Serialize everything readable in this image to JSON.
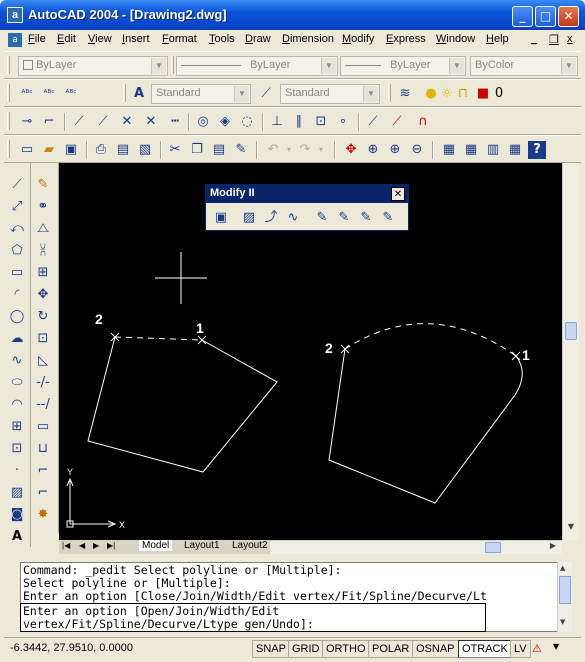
{
  "window": {
    "title": "AutoCAD 2004 - [Drawing2.dwg]",
    "app_icon_letter": "a",
    "controls": {
      "minimize": "_",
      "maximize": "□",
      "close": "✕"
    }
  },
  "menubar": {
    "items": [
      "File",
      "Edit",
      "View",
      "Insert",
      "Format",
      "Tools",
      "Draw",
      "Dimension",
      "Modify",
      "Express",
      "Window",
      "Help"
    ],
    "doc_controls": {
      "minimize": "_",
      "restore": "❐",
      "close": "x"
    }
  },
  "properties_toolbar": {
    "layer": "ByLayer",
    "linetype": "ByLayer",
    "lineweight": "ByLayer",
    "color": "ByColor"
  },
  "styles_toolbar": {
    "text_style": "Standard",
    "dim_style": "Standard",
    "layer_state": "0"
  },
  "palette": {
    "title": "Modify II",
    "close": "✕"
  },
  "drawing": {
    "labels": {
      "left_1": "1",
      "left_2": "2",
      "right_1": "1",
      "right_2": "2"
    },
    "ucs": {
      "x": "X",
      "y": "Y"
    }
  },
  "layout_tabs": [
    "Model",
    "Layout1",
    "Layout2"
  ],
  "command": {
    "history": [
      "Command: _pedit Select polyline or [Multiple]:",
      "Select polyline or [Multiple]:",
      "Enter an option [Close/Join/Width/Edit vertex/Fit/Spline/Decurve/Lt"
    ],
    "prompt_line1": "Enter an option [Open/Join/Width/Edit",
    "prompt_line2": "vertex/Fit/Spline/Decurve/Ltype gen/Undo]:"
  },
  "status": {
    "coordinates": "-6.3442, 27.9510, 0.0000",
    "toggles": [
      "SNAP",
      "GRID",
      "ORTHO",
      "POLAR",
      "OSNAP",
      "OTRACK",
      "LV"
    ]
  }
}
